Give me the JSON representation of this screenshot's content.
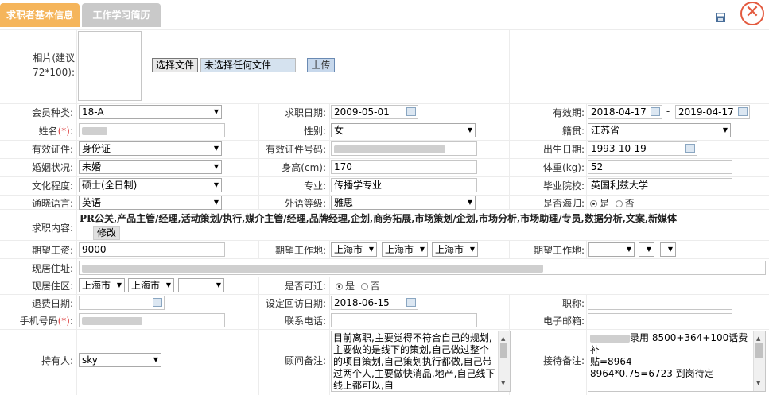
{
  "tabs": [
    {
      "label": "求职者基本信息"
    },
    {
      "label": "工作学习简历"
    }
  ],
  "photo": {
    "label_line1": "相片(建议",
    "label_line2": "72*100):",
    "file_button": "选择文件",
    "file_status": "未选择任何文件",
    "upload_button": "上传"
  },
  "fields": {
    "member_type": {
      "label": "会员种类:",
      "value": "18-A"
    },
    "apply_date": {
      "label": "求职日期:",
      "value": "2009-05-01"
    },
    "valid_period": {
      "label": "有效期:",
      "start": "2018-04-17",
      "sep": "-",
      "end": "2019-04-17"
    },
    "name": {
      "label": "姓名",
      "req": "(*)",
      "colon": ":"
    },
    "gender": {
      "label": "性别:",
      "value": "女"
    },
    "native_place": {
      "label": "籍贯:",
      "value": "江苏省"
    },
    "id_type": {
      "label": "有效证件:",
      "value": "身份证"
    },
    "id_number": {
      "label": "有效证件号码:"
    },
    "birth_date": {
      "label": "出生日期:",
      "value": "1993-10-19"
    },
    "marital": {
      "label": "婚姻状况:",
      "value": "未婚"
    },
    "height": {
      "label": "身高(cm):",
      "value": "170"
    },
    "weight": {
      "label": "体重(kg):",
      "value": "52"
    },
    "education": {
      "label": "文化程度:",
      "value": "硕士(全日制)"
    },
    "major": {
      "label": "专业:",
      "value": "传播学专业"
    },
    "school": {
      "label": "毕业院校:",
      "value": "英国利兹大学"
    },
    "language": {
      "label": "通晓语言:",
      "value": "英语"
    },
    "lang_level": {
      "label": "外语等级:",
      "value": "雅思"
    },
    "overseas": {
      "label": "是否海归:",
      "yes": "是",
      "no": "否"
    },
    "job_content": {
      "label": "求职内容:",
      "value": "PR公关,产品主管/经理,活动策划/执行,媒介主管/经理,品牌经理,企划,商务拓展,市场策划/企划,市场分析,市场助理/专员,数据分析,文案,新媒体",
      "modify_button": "修改"
    },
    "salary": {
      "label": "期望工资:",
      "value": "9000"
    },
    "work_place1": {
      "label": "期望工作地:",
      "values": [
        "上海市",
        "上海市",
        "上海市"
      ]
    },
    "work_place2": {
      "label": "期望工作地:"
    },
    "address": {
      "label": "现居住址:"
    },
    "district": {
      "label": "现居住区:",
      "values": [
        "上海市",
        "上海市"
      ]
    },
    "relocate": {
      "label": "是否可迁:",
      "yes": "是",
      "no": "否"
    },
    "refund_date": {
      "label": "退费日期:"
    },
    "visit_date": {
      "label": "设定回访日期:",
      "value": "2018-06-15"
    },
    "title": {
      "label": "职称:"
    },
    "mobile": {
      "label": "手机号码",
      "req": "(*)",
      "colon": ":"
    },
    "phone": {
      "label": "联系电话:"
    },
    "email": {
      "label": "电子邮箱:"
    },
    "holder": {
      "label": "持有人:",
      "value": "sky"
    },
    "consultant_note": {
      "label": "顾问备注:",
      "value": "目前离职,主要觉得不符合自己的规划,主要做的是线下的策划,自己做过整个的项目策划,自己策划执行都做,自己带过两个人,主要做快消品,地产,自己线下线上都可以,自"
    },
    "reception_note": {
      "label": "接待备注:",
      "line1": "录用  8500+364+100话费补",
      "line2": "贴=8964",
      "line3": "8964*0.75=6723  到岗待定"
    }
  },
  "colors": {
    "active_tab": "#f5b55b",
    "inactive_tab": "#c9c9c9",
    "close": "#e35a3f"
  }
}
